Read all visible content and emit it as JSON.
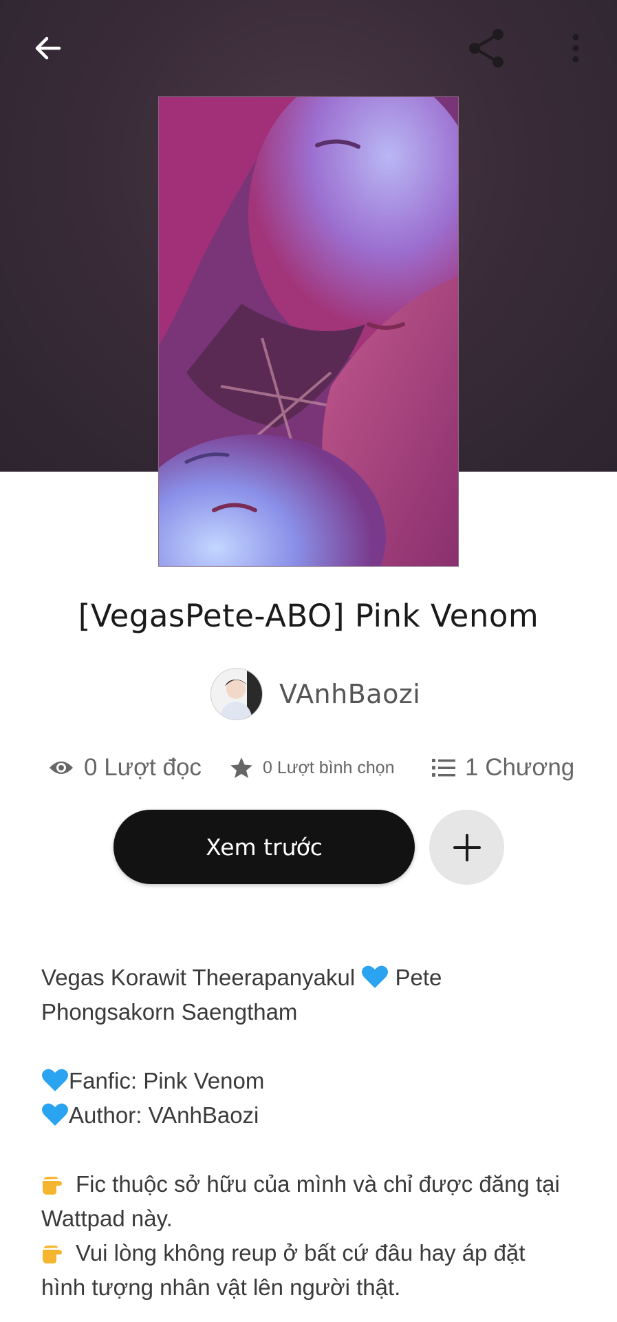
{
  "header": {
    "back_icon": "arrow-left-icon",
    "share_icon": "share-icon",
    "more_icon": "more-vertical-icon"
  },
  "story": {
    "title": "[VegasPete-ABO] Pink Venom",
    "author": "VAnhBaozi"
  },
  "stats": {
    "reads": "0 Lượt đọc",
    "votes": "0 Lượt bình chọn",
    "chapters": "1 Chương"
  },
  "actions": {
    "read_label": "Xem trước",
    "add_icon": "plus-icon"
  },
  "description": {
    "line1_a": "Vegas Korawit Theerapanyakul ",
    "line1_b": " Pete",
    "line2": "Phongsakorn Saengtham",
    "line3": "Fanfic: Pink Venom",
    "line4": "Author: VAnhBaozi",
    "line5": "Fic thuộc sở hữu của mình và chỉ được đăng tại",
    "line6": "Wattpad này.",
    "line7": "Vui lòng không reup ở bất cứ đâu hay áp đặt",
    "line8": "hình tượng nhân vật lên người thật."
  },
  "colors": {
    "hero_bg": "#3a2c38",
    "button_dark": "#121212",
    "heart_blue": "#2aa3f0",
    "stat_gray": "#666666"
  }
}
